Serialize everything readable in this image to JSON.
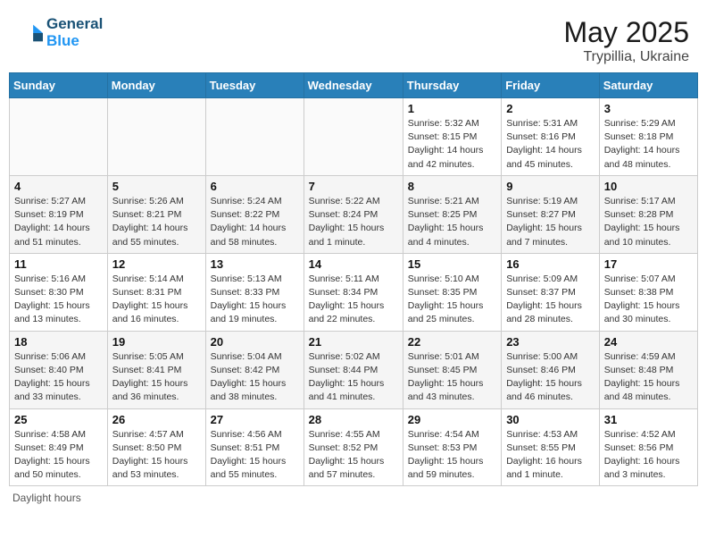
{
  "header": {
    "logo_line1": "General",
    "logo_line2": "Blue",
    "month_year": "May 2025",
    "location": "Trypillia, Ukraine"
  },
  "weekdays": [
    "Sunday",
    "Monday",
    "Tuesday",
    "Wednesday",
    "Thursday",
    "Friday",
    "Saturday"
  ],
  "weeks": [
    [
      {
        "day": "",
        "info": ""
      },
      {
        "day": "",
        "info": ""
      },
      {
        "day": "",
        "info": ""
      },
      {
        "day": "",
        "info": ""
      },
      {
        "day": "1",
        "info": "Sunrise: 5:32 AM\nSunset: 8:15 PM\nDaylight: 14 hours\nand 42 minutes."
      },
      {
        "day": "2",
        "info": "Sunrise: 5:31 AM\nSunset: 8:16 PM\nDaylight: 14 hours\nand 45 minutes."
      },
      {
        "day": "3",
        "info": "Sunrise: 5:29 AM\nSunset: 8:18 PM\nDaylight: 14 hours\nand 48 minutes."
      }
    ],
    [
      {
        "day": "4",
        "info": "Sunrise: 5:27 AM\nSunset: 8:19 PM\nDaylight: 14 hours\nand 51 minutes."
      },
      {
        "day": "5",
        "info": "Sunrise: 5:26 AM\nSunset: 8:21 PM\nDaylight: 14 hours\nand 55 minutes."
      },
      {
        "day": "6",
        "info": "Sunrise: 5:24 AM\nSunset: 8:22 PM\nDaylight: 14 hours\nand 58 minutes."
      },
      {
        "day": "7",
        "info": "Sunrise: 5:22 AM\nSunset: 8:24 PM\nDaylight: 15 hours\nand 1 minute."
      },
      {
        "day": "8",
        "info": "Sunrise: 5:21 AM\nSunset: 8:25 PM\nDaylight: 15 hours\nand 4 minutes."
      },
      {
        "day": "9",
        "info": "Sunrise: 5:19 AM\nSunset: 8:27 PM\nDaylight: 15 hours\nand 7 minutes."
      },
      {
        "day": "10",
        "info": "Sunrise: 5:17 AM\nSunset: 8:28 PM\nDaylight: 15 hours\nand 10 minutes."
      }
    ],
    [
      {
        "day": "11",
        "info": "Sunrise: 5:16 AM\nSunset: 8:30 PM\nDaylight: 15 hours\nand 13 minutes."
      },
      {
        "day": "12",
        "info": "Sunrise: 5:14 AM\nSunset: 8:31 PM\nDaylight: 15 hours\nand 16 minutes."
      },
      {
        "day": "13",
        "info": "Sunrise: 5:13 AM\nSunset: 8:33 PM\nDaylight: 15 hours\nand 19 minutes."
      },
      {
        "day": "14",
        "info": "Sunrise: 5:11 AM\nSunset: 8:34 PM\nDaylight: 15 hours\nand 22 minutes."
      },
      {
        "day": "15",
        "info": "Sunrise: 5:10 AM\nSunset: 8:35 PM\nDaylight: 15 hours\nand 25 minutes."
      },
      {
        "day": "16",
        "info": "Sunrise: 5:09 AM\nSunset: 8:37 PM\nDaylight: 15 hours\nand 28 minutes."
      },
      {
        "day": "17",
        "info": "Sunrise: 5:07 AM\nSunset: 8:38 PM\nDaylight: 15 hours\nand 30 minutes."
      }
    ],
    [
      {
        "day": "18",
        "info": "Sunrise: 5:06 AM\nSunset: 8:40 PM\nDaylight: 15 hours\nand 33 minutes."
      },
      {
        "day": "19",
        "info": "Sunrise: 5:05 AM\nSunset: 8:41 PM\nDaylight: 15 hours\nand 36 minutes."
      },
      {
        "day": "20",
        "info": "Sunrise: 5:04 AM\nSunset: 8:42 PM\nDaylight: 15 hours\nand 38 minutes."
      },
      {
        "day": "21",
        "info": "Sunrise: 5:02 AM\nSunset: 8:44 PM\nDaylight: 15 hours\nand 41 minutes."
      },
      {
        "day": "22",
        "info": "Sunrise: 5:01 AM\nSunset: 8:45 PM\nDaylight: 15 hours\nand 43 minutes."
      },
      {
        "day": "23",
        "info": "Sunrise: 5:00 AM\nSunset: 8:46 PM\nDaylight: 15 hours\nand 46 minutes."
      },
      {
        "day": "24",
        "info": "Sunrise: 4:59 AM\nSunset: 8:48 PM\nDaylight: 15 hours\nand 48 minutes."
      }
    ],
    [
      {
        "day": "25",
        "info": "Sunrise: 4:58 AM\nSunset: 8:49 PM\nDaylight: 15 hours\nand 50 minutes."
      },
      {
        "day": "26",
        "info": "Sunrise: 4:57 AM\nSunset: 8:50 PM\nDaylight: 15 hours\nand 53 minutes."
      },
      {
        "day": "27",
        "info": "Sunrise: 4:56 AM\nSunset: 8:51 PM\nDaylight: 15 hours\nand 55 minutes."
      },
      {
        "day": "28",
        "info": "Sunrise: 4:55 AM\nSunset: 8:52 PM\nDaylight: 15 hours\nand 57 minutes."
      },
      {
        "day": "29",
        "info": "Sunrise: 4:54 AM\nSunset: 8:53 PM\nDaylight: 15 hours\nand 59 minutes."
      },
      {
        "day": "30",
        "info": "Sunrise: 4:53 AM\nSunset: 8:55 PM\nDaylight: 16 hours\nand 1 minute."
      },
      {
        "day": "31",
        "info": "Sunrise: 4:52 AM\nSunset: 8:56 PM\nDaylight: 16 hours\nand 3 minutes."
      }
    ]
  ],
  "footer": "Daylight hours"
}
